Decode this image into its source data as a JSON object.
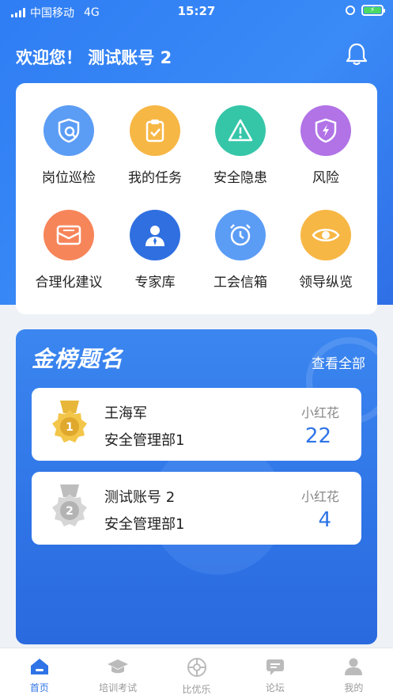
{
  "status": {
    "carrier": "中国移动",
    "network": "4G",
    "time": "15:27"
  },
  "header": {
    "welcome": "欢迎您！ 测试账号 2"
  },
  "grid": [
    {
      "label": "岗位巡检",
      "icon": "patrol-shield-icon",
      "color": "#5b9cf5"
    },
    {
      "label": "我的任务",
      "icon": "clipboard-check-icon",
      "color": "#f7b745"
    },
    {
      "label": "安全隐患",
      "icon": "warning-tool-icon",
      "color": "#35c6a8"
    },
    {
      "label": "风险",
      "icon": "shield-lightning-icon",
      "color": "#b173e6"
    },
    {
      "label": "合理化建议",
      "icon": "mail-icon",
      "color": "#f7855a"
    },
    {
      "label": "专家库",
      "icon": "expert-person-icon",
      "color": "#2f6fe0"
    },
    {
      "label": "工会信箱",
      "icon": "alarm-clock-icon",
      "color": "#5b9cf5"
    },
    {
      "label": "领导纵览",
      "icon": "eye-icon",
      "color": "#f7b745"
    }
  ],
  "leaderboard": {
    "title": "金榜题名",
    "more": "查看全部",
    "entries": [
      {
        "rank": "1",
        "name": "王海军",
        "dept": "安全管理部1",
        "flower_label": "小红花",
        "count": "22",
        "medal": "gold-medal-icon"
      },
      {
        "rank": "2",
        "name": "测试账号 2",
        "dept": "安全管理部1",
        "flower_label": "小红花",
        "count": "4",
        "medal": "silver-medal-icon"
      }
    ]
  },
  "tabs": [
    {
      "label": "首页",
      "icon": "home-icon",
      "active": true
    },
    {
      "label": "培训考试",
      "icon": "graduation-cap-icon",
      "active": false
    },
    {
      "label": "比优乐",
      "icon": "compass-icon",
      "active": false
    },
    {
      "label": "论坛",
      "icon": "chat-bubble-icon",
      "active": false
    },
    {
      "label": "我的",
      "icon": "user-icon",
      "active": false
    }
  ],
  "colors": {
    "primary": "#2f74e6",
    "tab_inactive": "#bbbbbb"
  }
}
